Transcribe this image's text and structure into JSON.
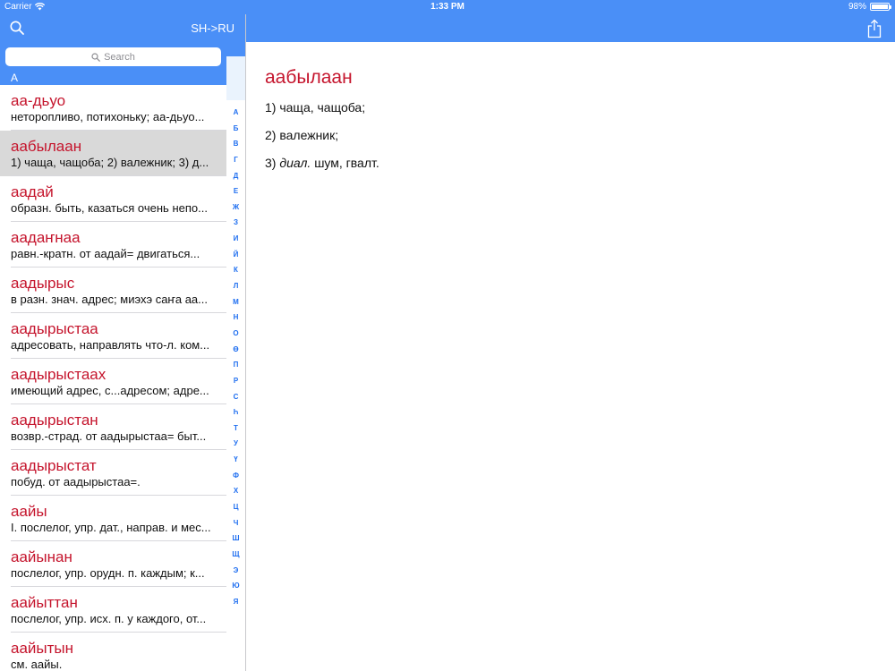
{
  "status_bar": {
    "carrier": "Carrier",
    "time": "1:33 PM",
    "battery": "98%",
    "battery_level": 0.98
  },
  "master": {
    "direction": "SH->RU",
    "search": {
      "placeholder": "Search"
    },
    "section_header": "А",
    "entries": [
      {
        "word": "аа-дьуо",
        "desc": "неторопливо, потихоньку; аа-дьуо..."
      },
      {
        "word": "аабылаан",
        "desc": "1) чаща, чащоба; 2) валежник; 3) д...",
        "selected": true
      },
      {
        "word": "аадай",
        "desc": "образн. быть, казаться очень непо..."
      },
      {
        "word": "аадаҥнаа",
        "desc": "равн.-кратн. от аадай= двигаться..."
      },
      {
        "word": "аадырыс",
        "desc": "в разн. знач. адрес; миэхэ саҥа аа..."
      },
      {
        "word": "аадырыстаа",
        "desc": "адресовать, направлять что-л. ком..."
      },
      {
        "word": "аадырыстаах",
        "desc": "имеющий адрес, с...адресом; адре..."
      },
      {
        "word": "аадырыстан",
        "desc": "возвр.-страд. от аадырыстаа= быт..."
      },
      {
        "word": "аадырыстат",
        "desc": "побуд. от аадырыстаа=."
      },
      {
        "word": "аайы",
        "desc": "I. послелог, упр. дат., направ. и мес..."
      },
      {
        "word": "аайынан",
        "desc": "послелог, упр. орудн. п. каждым; к..."
      },
      {
        "word": "аайыттан",
        "desc": "послелог, упр. исх. п. у каждого, от..."
      },
      {
        "word": "аайытын",
        "desc": "см. аайы."
      }
    ],
    "index_letters": [
      "А",
      "Б",
      "В",
      "Г",
      "Д",
      "Е",
      "Ж",
      "З",
      "И",
      "Й",
      "К",
      "Л",
      "М",
      "Н",
      "О",
      "Ө",
      "П",
      "Р",
      "С",
      "Һ",
      "Т",
      "У",
      "Ү",
      "Ф",
      "Х",
      "Ц",
      "Ч",
      "Ш",
      "Щ",
      "Э",
      "Ю",
      "Я"
    ]
  },
  "detail": {
    "word": "аабылаан",
    "senses": [
      {
        "num": "1)",
        "label": "",
        "text": "чаща, чащоба;"
      },
      {
        "num": "2)",
        "label": "",
        "text": "валежник;"
      },
      {
        "num": "3)",
        "label": "диал.",
        "text": "шум, гвалт."
      }
    ]
  },
  "icons": {
    "search": "search-icon",
    "share": "share-icon",
    "wifi": "wifi-icon",
    "battery": "battery-icon"
  },
  "colors": {
    "bar_blue": "#4a8ff7",
    "headword_red": "#c5152d",
    "index_blue": "#1e6ef0",
    "selected_bg": "#d9d9d9"
  }
}
